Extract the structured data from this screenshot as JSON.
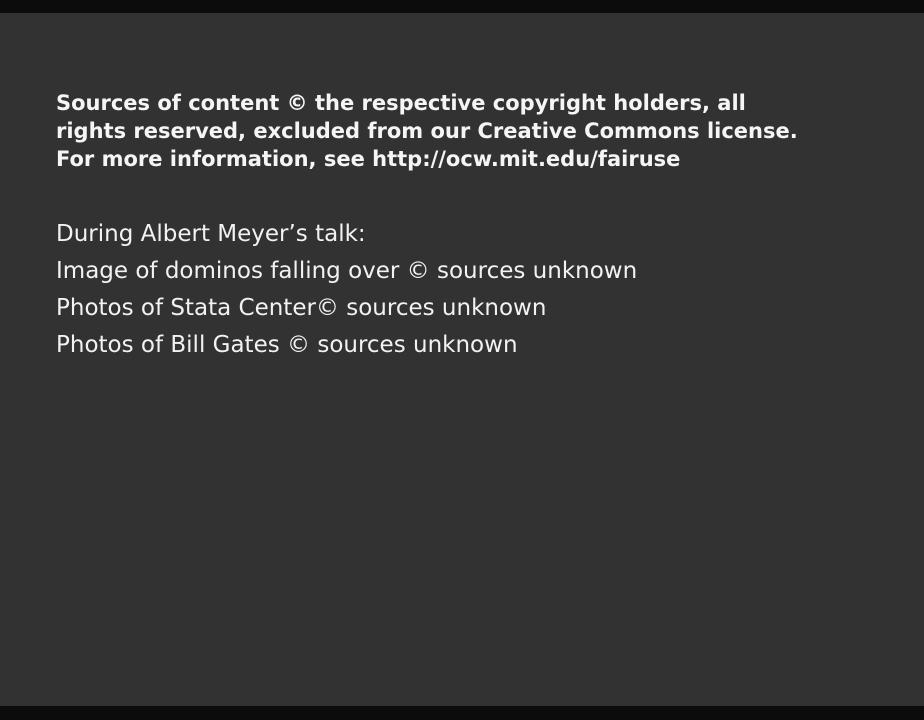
{
  "notice": {
    "lines": [
      "Sources of content © the respective copyright holders, all",
      "rights reserved, excluded from our Creative Commons license.",
      "For more information, see http://ocw.mit.edu/fairuse"
    ]
  },
  "credits": {
    "heading": "During Albert Meyer’s talk:",
    "items": [
      "Image of dominos falling over © sources unknown",
      "Photos of Stata Center© sources unknown",
      "Photos of Bill Gates © sources unknown"
    ]
  },
  "colors": {
    "background": "#323232",
    "letterbox": "#0c0c0c",
    "text": "#f5f5f5"
  }
}
